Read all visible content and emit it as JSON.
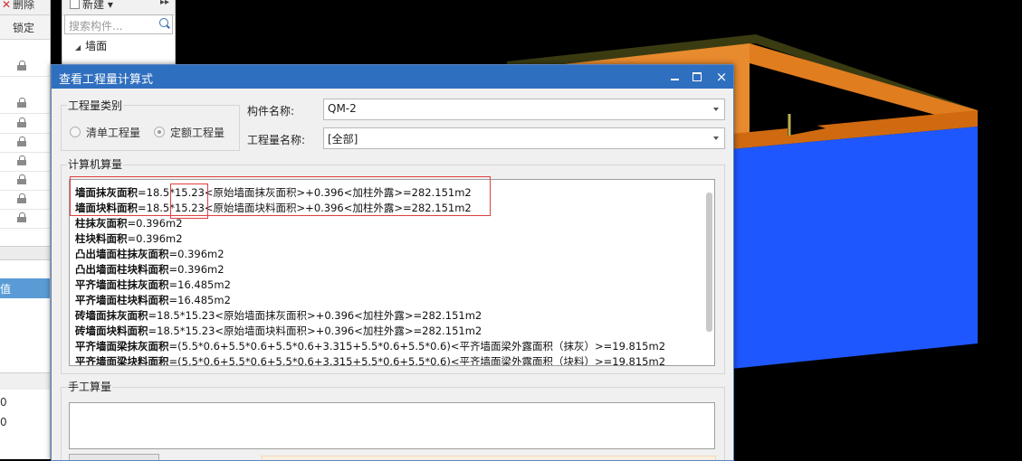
{
  "background_app": {
    "left_panel": {
      "delete_label": "删除",
      "lock_header": "锁定",
      "selected_row_text": "值",
      "bottom_numbers": [
        "0",
        "0"
      ]
    },
    "mid_panel": {
      "new_label": "新建",
      "search_placeholder": "搜索构件...",
      "tree_root": "墙面"
    }
  },
  "colors": {
    "wall_blue": "#1f57ff",
    "wall_orange": "#e88a2e",
    "wall_top": "#3b3b12",
    "title_bar": "#2f6fbf",
    "highlight": "#e04040"
  },
  "dialog": {
    "title": "查看工程量计算式",
    "controls": {
      "minimize": "minimize-icon",
      "maximize": "maximize-icon",
      "close": "×"
    },
    "quantity_type": {
      "group_label": "工程量类别",
      "options": [
        {
          "label": "清单工程量",
          "checked": false
        },
        {
          "label": "定额工程量",
          "checked": true
        }
      ]
    },
    "component_name": {
      "label": "构件名称:",
      "value": "QM-2"
    },
    "quantity_name": {
      "label": "工程量名称:",
      "value": "[全部]"
    },
    "computed": {
      "group_label": "计算机算量",
      "lines": [
        {
          "name": "墙面抹灰面积",
          "expr": "=18.5*15.23<原始墙面抹灰面积>+0.396<加柱外露>=282.151m2"
        },
        {
          "name": "墙面块料面积",
          "expr": "=18.5*15.23<原始墙面块料面积>+0.396<加柱外露>=282.151m2"
        },
        {
          "name": "柱抹灰面积",
          "expr": "=0.396m2"
        },
        {
          "name": "柱块料面积",
          "expr": "=0.396m2"
        },
        {
          "name": "凸出墙面柱抹灰面积",
          "expr": "=0.396m2"
        },
        {
          "name": "凸出墙面柱块料面积",
          "expr": "=0.396m2"
        },
        {
          "name": "平齐墙面柱抹灰面积",
          "expr": "=16.485m2"
        },
        {
          "name": "平齐墙面柱块料面积",
          "expr": "=16.485m2"
        },
        {
          "name": "砖墙面抹灰面积",
          "expr": "=18.5*15.23<原始墙面抹灰面积>+0.396<加柱外露>=282.151m2"
        },
        {
          "name": "砖墙面块料面积",
          "expr": "=18.5*15.23<原始墙面块料面积>+0.396<加柱外露>=282.151m2"
        },
        {
          "name": "平齐墙面梁抹灰面积",
          "expr": "=(5.5*0.6+5.5*0.6+5.5*0.6+3.315+5.5*0.6+5.5*0.6)<平齐墙面梁外露面积（抹灰）>=19.815m2"
        },
        {
          "name": "平齐墙面梁块料面积",
          "expr": "=(5.5*0.6+5.5*0.6+5.5*0.6+3.315+5.5*0.6+5.5*0.6)<平齐墙面梁外露面积（块料）>=19.815m2"
        }
      ]
    },
    "manual": {
      "group_label": "手工算量",
      "value": ""
    }
  }
}
